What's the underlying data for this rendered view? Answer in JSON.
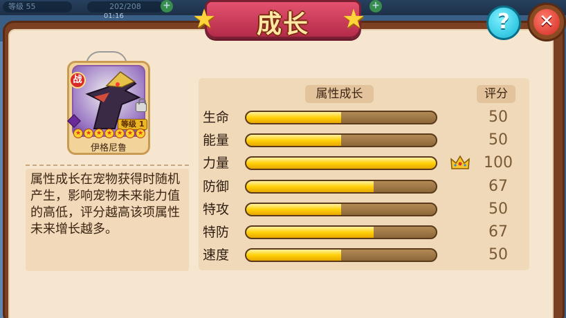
{
  "hud": {
    "level": "等级 55",
    "energy": "202/208",
    "timer": "01:16"
  },
  "title": "成长",
  "pet": {
    "badge": "战",
    "level_badge": "等级 1",
    "name": "伊格尼鲁",
    "stars": 7
  },
  "description": "属性成长在宠物获得时随机产生，影响宠物未来能力值的高低，评分越高该项属性未来增长越多。",
  "table": {
    "header_growth": "属性成长",
    "header_score": "评分",
    "rows": [
      {
        "label": "生命",
        "fill": 0.5,
        "score": "50",
        "crown": false
      },
      {
        "label": "能量",
        "fill": 0.5,
        "score": "50",
        "crown": false
      },
      {
        "label": "力量",
        "fill": 1.0,
        "score": "100",
        "crown": true
      },
      {
        "label": "防御",
        "fill": 0.67,
        "score": "67",
        "crown": false
      },
      {
        "label": "特攻",
        "fill": 0.5,
        "score": "50",
        "crown": false
      },
      {
        "label": "特防",
        "fill": 0.67,
        "score": "67",
        "crown": false
      },
      {
        "label": "速度",
        "fill": 0.5,
        "score": "50",
        "crown": false
      }
    ]
  },
  "buttons": {
    "help": "?",
    "close": "✕"
  },
  "colors": {
    "bar_fill": "#ffd10a",
    "ribbon": "#c83a58",
    "panel": "#f6e6cf"
  }
}
